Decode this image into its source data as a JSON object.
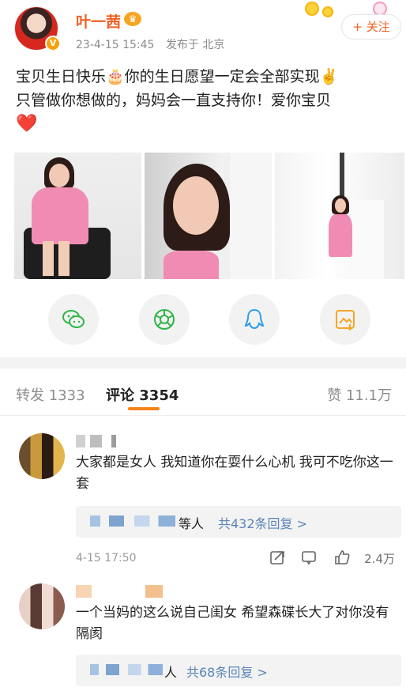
{
  "post": {
    "username": "叶一茜",
    "date": "23-4-15 15:45",
    "location": "发布于 北京",
    "follow_label": "+ 关注",
    "text_line1": "宝贝生日快乐🎂你的生日愿望一定会全部实现✌️",
    "text_line2": "只管做你想做的，妈妈会一直支持你！爱你宝贝",
    "heart": "❤️"
  },
  "share_bar": {
    "items": [
      {
        "name": "wechat",
        "icon": "wechat-icon",
        "color": "#2fb548"
      },
      {
        "name": "moments",
        "icon": "moments-icon",
        "color": "#2fb548"
      },
      {
        "name": "qq",
        "icon": "qq-icon",
        "color": "#2f9ce6"
      },
      {
        "name": "save-image",
        "icon": "save-image-icon",
        "color": "#f5a623"
      }
    ]
  },
  "tabs": {
    "repost": "转发 1333",
    "comments": "评论 3354",
    "likes": "赞 11.1万",
    "indicator_color": "#f48518"
  },
  "comments": [
    {
      "text": "大家都是女人 我知道你在耍什么心机 我可不吃你这一套",
      "reply_suffix": "等人",
      "reply_link": "共432条回复 >",
      "time": "4-15 17:50",
      "likes": "2.4万"
    },
    {
      "text": "一个当妈的这么说自己闺女 希望森碟长大了对你没有隔阂",
      "reply_suffix": "人",
      "reply_link": "共68条回复 >"
    }
  ],
  "colors": {
    "username": "#f16022",
    "link": "#5b84b8",
    "meta": "#8a8a8a"
  }
}
